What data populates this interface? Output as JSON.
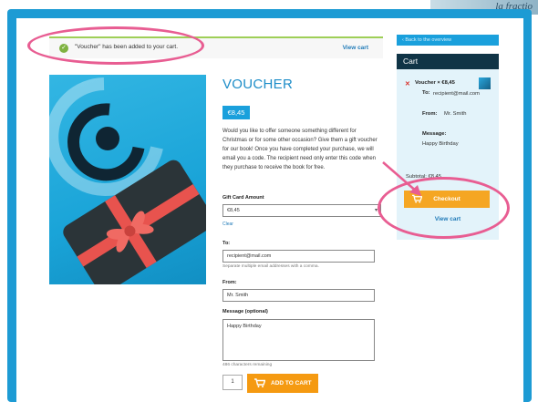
{
  "corner": {
    "text": "la fractio"
  },
  "notice": {
    "message": "\"Voucher\" has been added to your cart.",
    "link": "View cart",
    "icon": "checkmark-icon"
  },
  "product": {
    "title": "VOUCHER",
    "price": "€8,45",
    "description": "Would you like to offer someone something different for Christmas or for some other occasion? Give them a gift voucher for our book! Once you have completed your purchase, we will email you a code. The recipient need only enter this code when they purchase to receive the book for free.",
    "image_icon": "gift-card-image"
  },
  "form": {
    "amount_label": "Gift Card Amount",
    "amount_value": "€8,45",
    "clear": "Clear",
    "to_label": "To:",
    "to_value": "recipient@mail.com",
    "to_help": "Separate multiple email addresses with a comma.",
    "from_label": "From:",
    "from_value": "Mr. Smith",
    "message_label": "Message (optional)",
    "message_value": "Happy Birthday",
    "message_help": "486 characters remaining",
    "quantity": "1",
    "add_to_cart": "ADD TO CART"
  },
  "sidebar": {
    "back": "Back to the overview",
    "cart_title": "Cart",
    "item_name": "Voucher",
    "item_price": "€8,45",
    "to_label": "To:",
    "to_value": "recipient@mail.com",
    "from_label": "From:",
    "from_value": "Mr. Smith",
    "message_label": "Message:",
    "message_value": "Happy Birthday",
    "subtotal": "Subtotal: €8,45",
    "checkout": "Checkout",
    "view_cart": "View cart"
  },
  "colors": {
    "frame": "#1d9bd4",
    "accent_blue": "#1aa0dc",
    "orange": "#f59a11",
    "highlight": "#e85d92",
    "cart_header": "#103446"
  }
}
